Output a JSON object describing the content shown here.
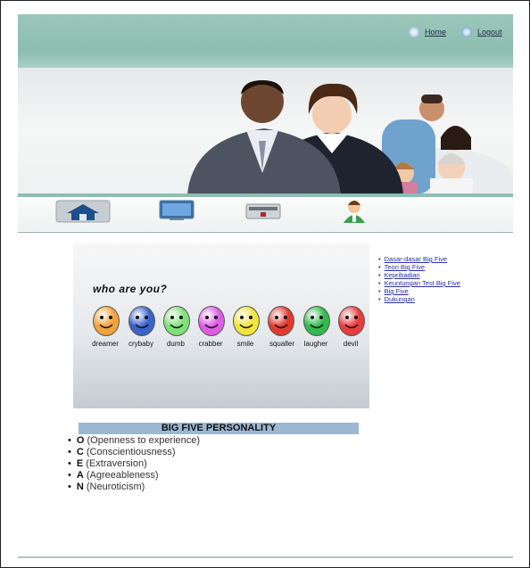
{
  "header": {
    "home_label": "Home",
    "logout_label": "Logout"
  },
  "slider": {
    "heading": "who are you?",
    "faces": [
      {
        "label": "dreamer",
        "color": "#f2a23b"
      },
      {
        "label": "crybaby",
        "color": "#3a62c9"
      },
      {
        "label": "dumb",
        "color": "#7fe07a"
      },
      {
        "label": "crabber",
        "color": "#e05ce6"
      },
      {
        "label": "smile",
        "color": "#f1e43c"
      },
      {
        "label": "squaller",
        "color": "#e23a2f"
      },
      {
        "label": "laugher",
        "color": "#31b94c"
      },
      {
        "label": "devil",
        "color": "#e83d3d"
      }
    ]
  },
  "sidebar": {
    "links": [
      "Dasar-dasar Big Five",
      "Teori Big Five",
      "Kepribadian",
      "Keuntungan Test Big Five",
      "Big Five",
      "Dukungan"
    ]
  },
  "bigfive": {
    "title": "BIG FIVE PERSONALITY",
    "items": [
      {
        "letter": "O",
        "desc": "(Openness to experience)"
      },
      {
        "letter": "C",
        "desc": "(Conscientiousness)"
      },
      {
        "letter": "E",
        "desc": "(Extraversion)"
      },
      {
        "letter": "A",
        "desc": "(Agreeableness)"
      },
      {
        "letter": "N",
        "desc": "(Neuroticism)"
      }
    ]
  },
  "icons": {
    "nav": [
      "home-icon",
      "monitor-icon",
      "device-icon",
      "user-icon"
    ]
  }
}
